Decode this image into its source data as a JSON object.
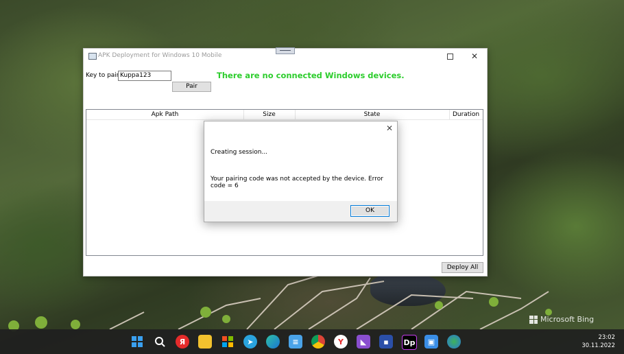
{
  "window": {
    "title": "APK Deployment for Windows 10 Mobile",
    "key_label": "Key to pair",
    "key_value": "Kuppa123",
    "pair_label": "Pair",
    "status_text": "There are no connected Windows devices.",
    "columns": [
      "Apk Path",
      "Size",
      "State",
      "Duration"
    ],
    "deploy_all_label": "Deploy All"
  },
  "dialog": {
    "line1": "Creating session...",
    "line2": "Your pairing code was not accepted by the device. Error code = 6",
    "ok_label": "OK"
  },
  "desktop": {
    "watermark": "Microsoft Bing"
  },
  "taskbar": {
    "time": "23:02",
    "date": "30.11.2022",
    "icons": [
      "start-icon",
      "search-icon",
      "yandex-browser-icon",
      "file-explorer-icon",
      "store-icon",
      "telegram-icon",
      "edge-icon",
      "notepad-icon",
      "chrome-icon",
      "yandex-icon",
      "visual-studio-icon",
      "save-icon",
      "jetbrains-icon",
      "app-window-icon",
      "earth-icon"
    ]
  },
  "colors": {
    "status_green": "#2dcd2d",
    "focus_blue": "#0078d7"
  }
}
